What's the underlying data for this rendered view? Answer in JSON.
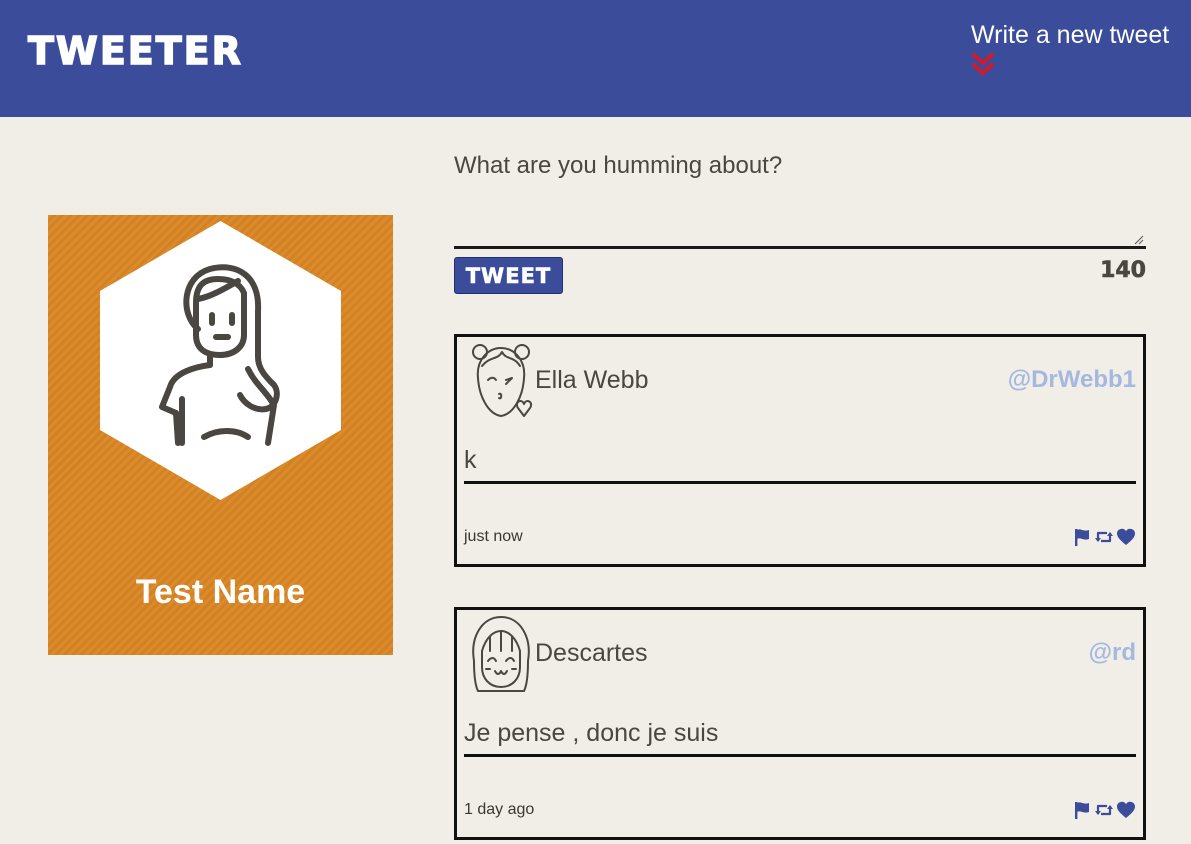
{
  "header": {
    "brand": "TWEETER",
    "compose_toggle_label": "Write a new tweet",
    "compose_toggle_icon": "double-chevron-down-icon",
    "compose_toggle_icon_color": "#e0141e"
  },
  "colors": {
    "nav_background": "#3b4d9a",
    "page_background": "#f1eee8",
    "profile_background": "#da8624",
    "handle": "#a5b8e0",
    "action_icons": "#3b4d9a"
  },
  "profile": {
    "name": "Test Name",
    "avatar_icon": "woman-long-hair-avatar"
  },
  "compose": {
    "prompt": "What are you humming about?",
    "input_value": "",
    "submit_label": "TWEET",
    "char_counter": "140"
  },
  "tweets": [
    {
      "name": "Ella Webb",
      "handle": "@DrWebb1",
      "avatar_icon": "girl-blowing-kiss-avatar",
      "body": "k",
      "time": "just now",
      "actions": [
        "flag-icon",
        "retweet-icon",
        "heart-icon"
      ]
    },
    {
      "name": "Descartes",
      "handle": "@rd",
      "avatar_icon": "girl-bangs-smiling-avatar",
      "body": "Je pense , donc je suis",
      "time": "1 day ago",
      "actions": [
        "flag-icon",
        "retweet-icon",
        "heart-icon"
      ]
    }
  ]
}
